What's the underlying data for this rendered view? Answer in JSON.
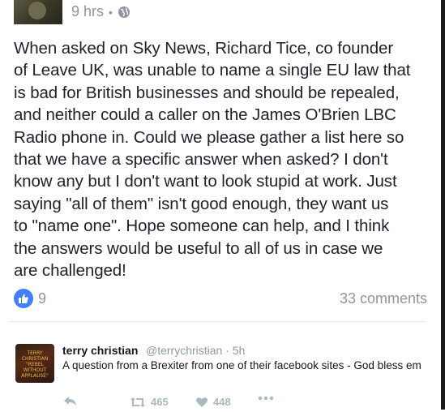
{
  "post": {
    "time": "9 hrs",
    "separator": "•",
    "body": "When asked on Sky News, Richard Tice, co founder\nof Leave UK, was unable to name a single EU law that\nis bad for British businesses and should be repealed,\nand neither could a caller on the James O'Brien LBC\nRadio phone in. Could we please gather a list here so\nthat we have a specific answer when asked? I don't\nknow any but I don't want to look stupid at work. Just\nsaying \"all of them\" isn't good enough, they want us\nto \"name one\". Hope someone can help, and I think\nthe answers would be useful to all of us in case we\nare challenged!",
    "reactions_count": "9",
    "comments_label": "33 comments",
    "colors": {
      "like_blue": "#4080ff",
      "meta_gray": "#90949c"
    }
  },
  "tweet": {
    "name": "terry christian",
    "handle_time": "@terrychristian · 5h",
    "text": "A question from a Brexiter from one of their facebook sites - God bless em",
    "avatar_text": "TERRY CHRISTIAN \"REBEL WITHOUT APPLAUSE\"",
    "retweets": "465",
    "likes": "448",
    "icons": [
      "reply-icon",
      "retweet-icon",
      "heart-icon",
      "more-icon"
    ]
  }
}
